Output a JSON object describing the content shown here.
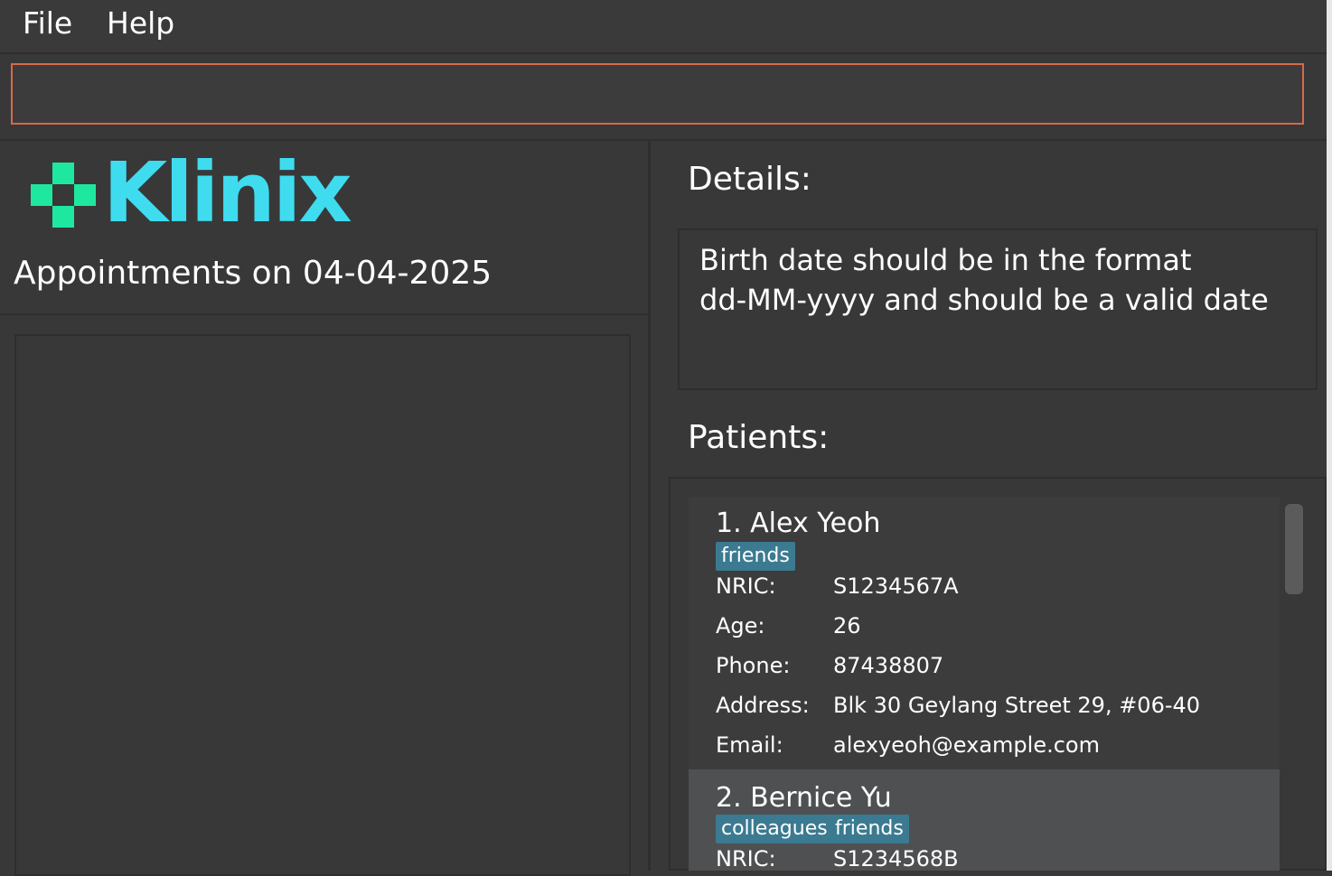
{
  "menu": {
    "file": "File",
    "help": "Help"
  },
  "command": {
    "value": ""
  },
  "logo": {
    "text": "Klinix",
    "cross_color": "#1ee8a0",
    "text_color": "#3fdcef"
  },
  "appointments": {
    "title": "Appointments on 04-04-2025"
  },
  "details": {
    "label": "Details:",
    "line1": "Birth date should be in the format",
    "line2": "dd-MM-yyyy and should be a valid date"
  },
  "patients": {
    "label": "Patients:",
    "list": [
      {
        "name": "1. Alex Yeoh",
        "tags": [
          "friends"
        ],
        "nric_label": "NRIC:",
        "nric": "S1234567A",
        "age_label": "Age:",
        "age": "26",
        "phone_label": "Phone:",
        "phone": "87438807",
        "address_label": "Address:",
        "address": "Blk 30 Geylang Street 29, #06-40",
        "email_label": "Email:",
        "email": "alexyeoh@example.com"
      },
      {
        "name": "2. Bernice Yu",
        "tags": [
          "colleagues",
          "friends"
        ],
        "nric_label": "NRIC:",
        "nric": "S1234568B"
      }
    ]
  },
  "colors": {
    "accent_border": "#d36a4c",
    "tag_bg": "#3b7a90",
    "background": "#383838"
  }
}
